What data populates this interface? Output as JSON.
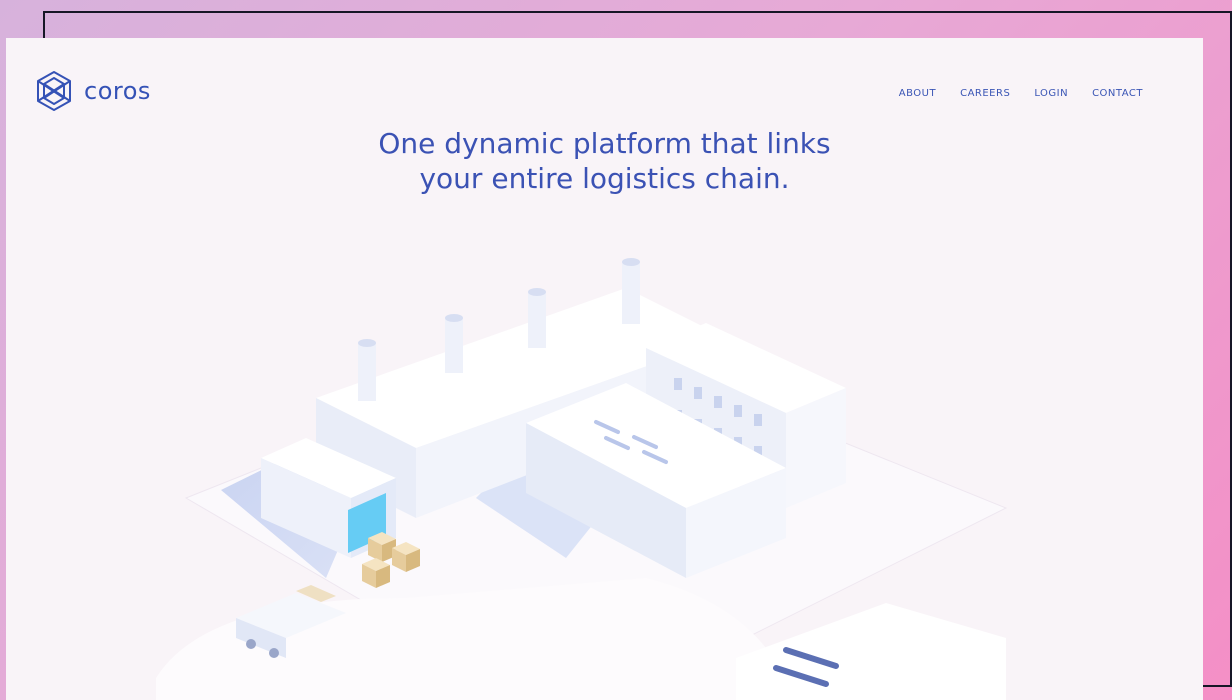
{
  "brand": {
    "name": "coros",
    "icon": "coros-logo-icon",
    "color": "#3552b6"
  },
  "nav": {
    "items": [
      "ABOUT",
      "CAREERS",
      "LOGIN",
      "CONTACT"
    ]
  },
  "hero": {
    "headline_line1": "One dynamic platform that links",
    "headline_line2": "your entire logistics chain."
  },
  "illustration": {
    "subject": "isometric-factory",
    "colors": {
      "building": "#ffffff",
      "shadow": "#b9c7ee",
      "boxes": "#ead1a6",
      "dock-light": "#66ccf4"
    }
  }
}
